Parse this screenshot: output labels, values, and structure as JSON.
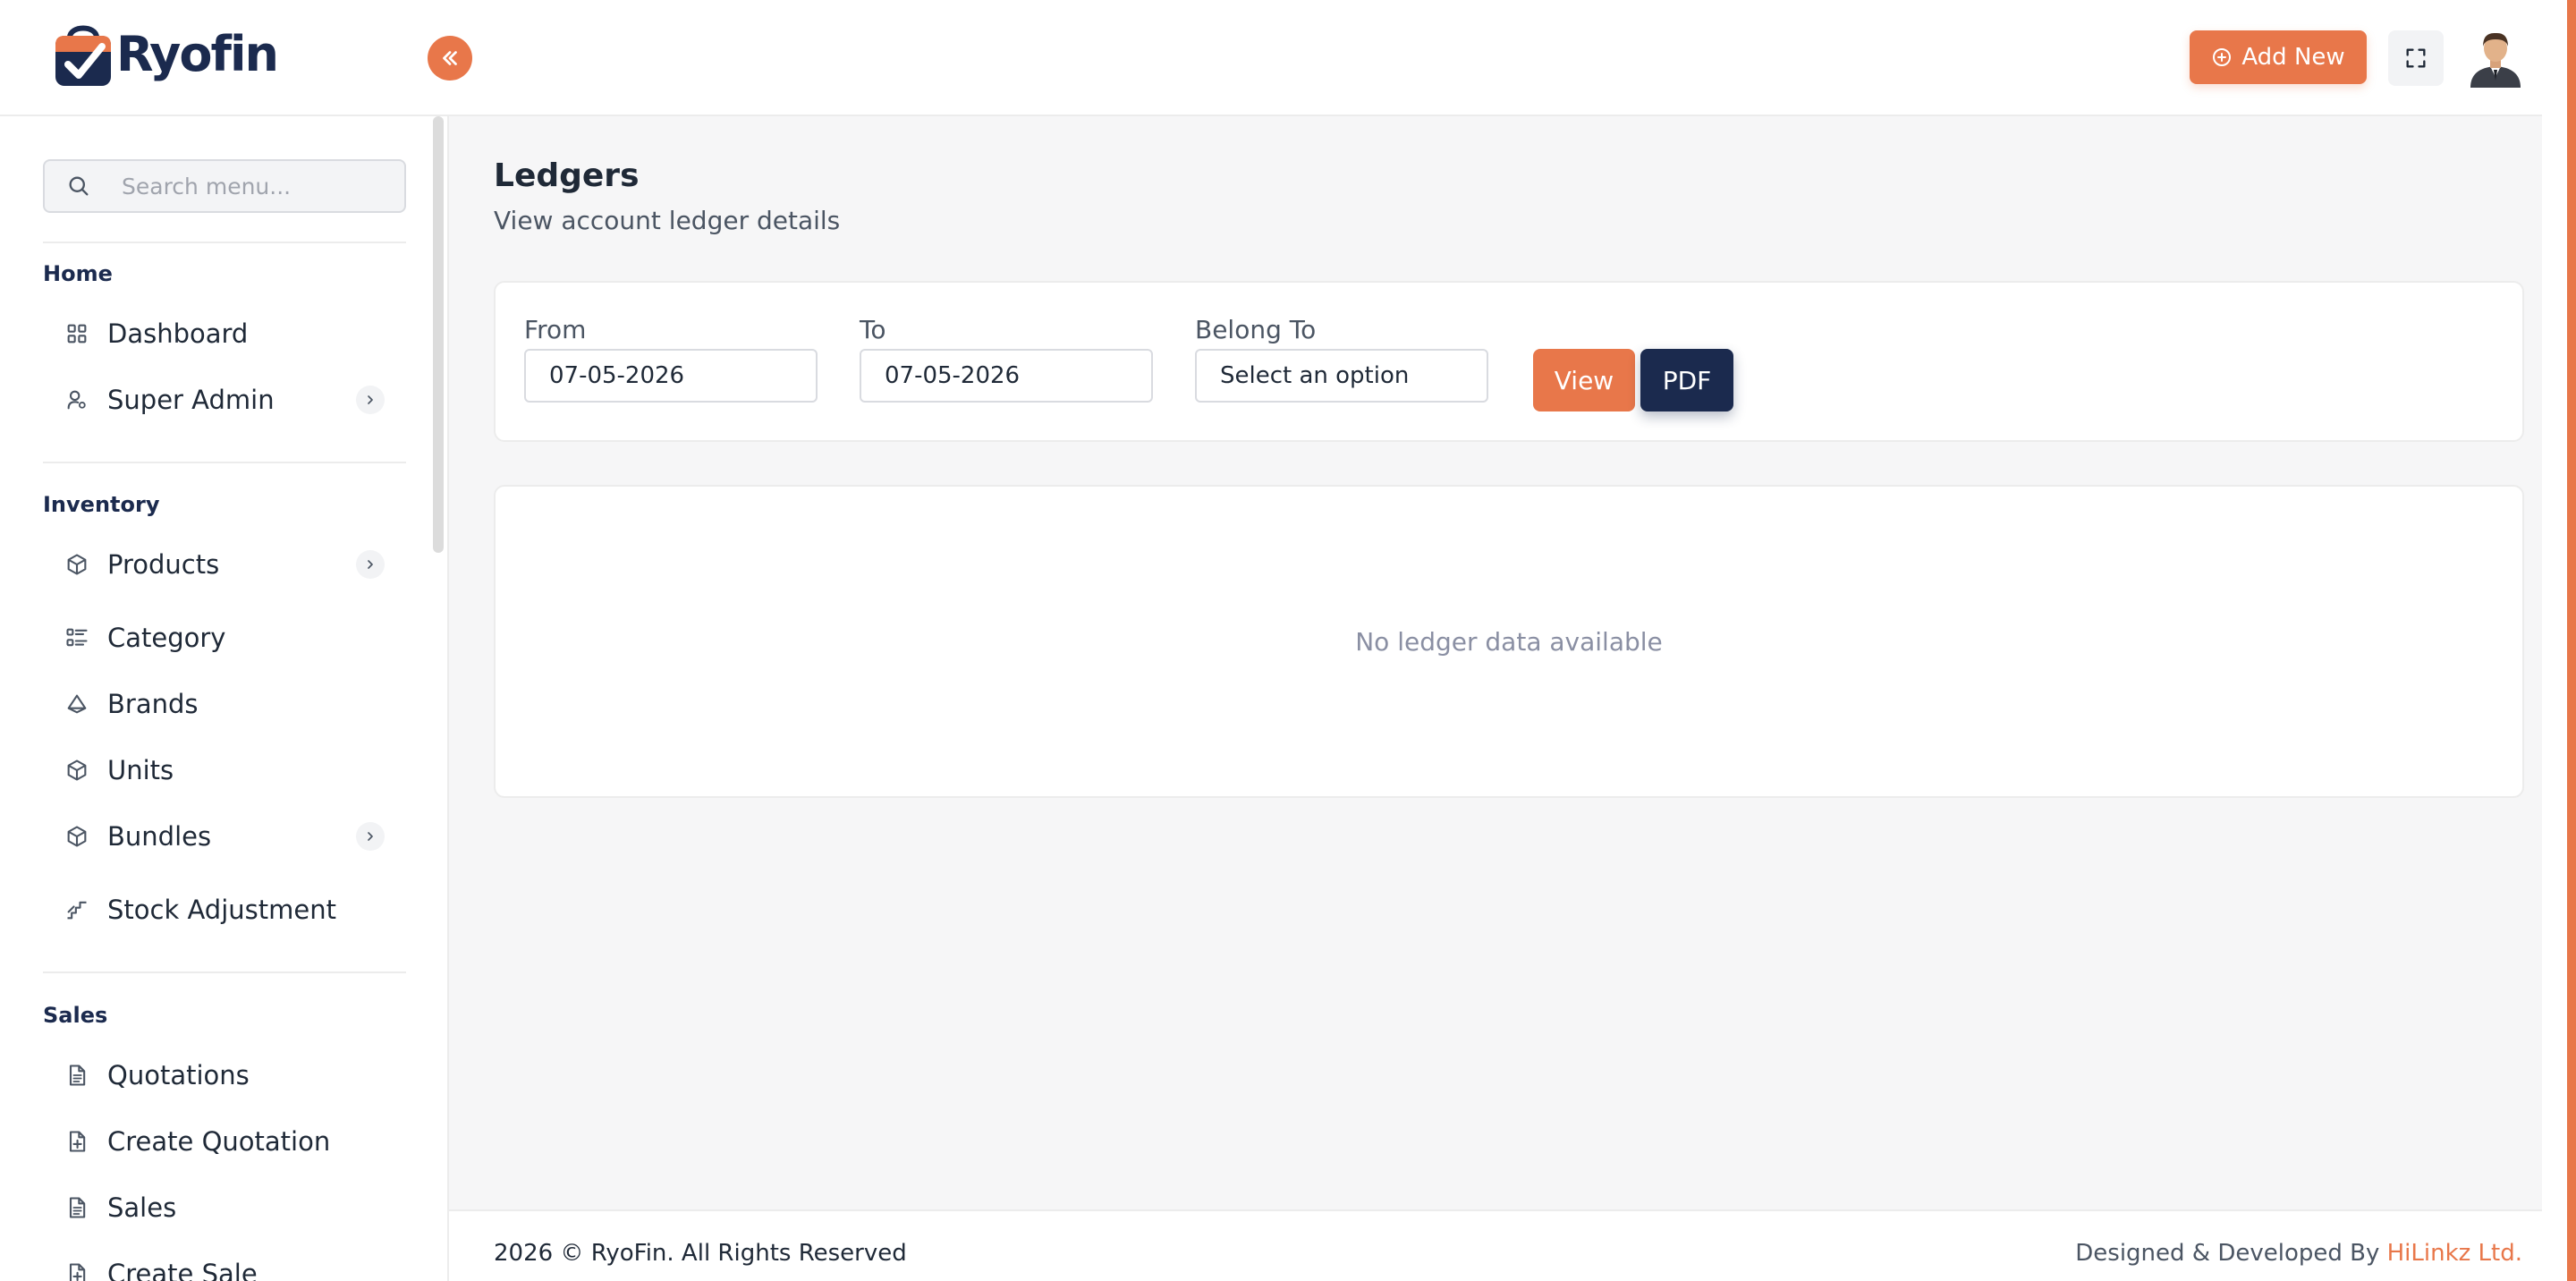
{
  "app": {
    "logo_text": "Ryofin",
    "accent_color": "#e8774a",
    "brand_color": "#1b2a4e"
  },
  "header": {
    "add_new_label": "Add New",
    "add_new_icon": "plus-circle-icon",
    "fullscreen_icon": "fullscreen-icon",
    "collapse_icon": "double-chevron-left-icon",
    "avatar_icon": "user-avatar"
  },
  "sidebar": {
    "search_placeholder": "Search menu...",
    "sections": [
      {
        "title": "Home",
        "items": [
          {
            "label": "Dashboard",
            "icon": "grid-icon",
            "has_children": false
          },
          {
            "label": "Super Admin",
            "icon": "user-settings-icon",
            "has_children": true
          }
        ]
      },
      {
        "title": "Inventory",
        "items": [
          {
            "label": "Products",
            "icon": "box-icon",
            "has_children": true
          },
          {
            "label": "Category",
            "icon": "list-icon",
            "has_children": false
          },
          {
            "label": "Brands",
            "icon": "brand-icon",
            "has_children": false
          },
          {
            "label": "Units",
            "icon": "box-icon",
            "has_children": false
          },
          {
            "label": "Bundles",
            "icon": "box-icon",
            "has_children": true
          },
          {
            "label": "Stock Adjustment",
            "icon": "stairs-icon",
            "has_children": false
          }
        ]
      },
      {
        "title": "Sales",
        "items": [
          {
            "label": "Quotations",
            "icon": "document-icon",
            "has_children": false
          },
          {
            "label": "Create Quotation",
            "icon": "document-add-icon",
            "has_children": false
          },
          {
            "label": "Sales",
            "icon": "document-icon",
            "has_children": false
          },
          {
            "label": "Create Sale",
            "icon": "document-add-icon",
            "has_children": false
          }
        ]
      }
    ]
  },
  "main": {
    "title": "Ledgers",
    "subtitle": "View account ledger details",
    "filters": {
      "from_label": "From",
      "from_value": "07-05-2026",
      "to_label": "To",
      "to_value": "07-05-2026",
      "belong_label": "Belong To",
      "belong_value": "Select an option",
      "view_label": "View",
      "pdf_label": "PDF"
    },
    "empty_message": "No ledger data available"
  },
  "footer": {
    "copyright": "2026 © RyoFin. All Rights Reserved",
    "designed_by": "Designed & Developed By ",
    "designer": "HiLinkz Ltd."
  }
}
